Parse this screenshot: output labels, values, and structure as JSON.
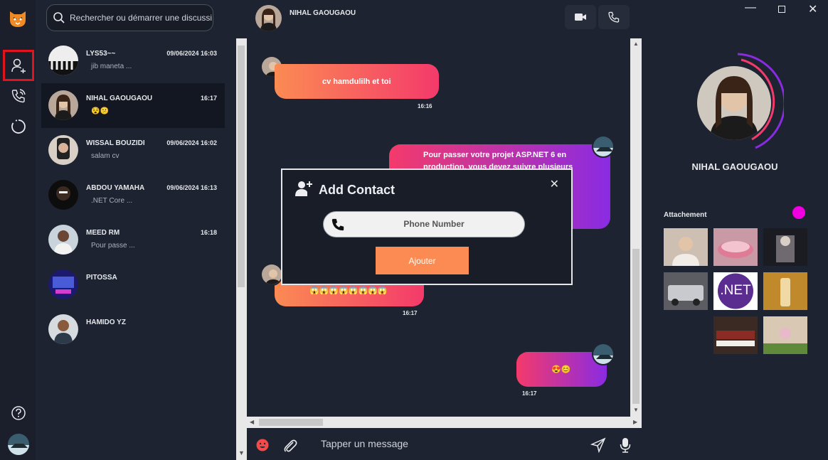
{
  "colors": {
    "accent_orange": "#fb8b53",
    "gradient_pink": "#f43a6b",
    "gradient_purple": "#8a2be2",
    "active_red": "#e0141e",
    "magenta_dot": "#f000e0"
  },
  "rail": {
    "items": [
      {
        "icon": "logo-tiger-icon"
      },
      {
        "icon": "add-contact-icon",
        "active": true
      },
      {
        "icon": "phone-call-icon"
      },
      {
        "icon": "status-ring-icon"
      },
      {
        "icon": "help-icon"
      },
      {
        "icon": "user-avatar-icon"
      }
    ]
  },
  "search": {
    "placeholder": "Rechercher ou démarrer une discussion"
  },
  "contacts": [
    {
      "name": "LYS53~~",
      "time": "09/06/2024 16:03",
      "preview": "jib maneta ..."
    },
    {
      "name": "NIHAL GAOUGAOU",
      "time": "16:17",
      "preview": "😵😕",
      "selected": true
    },
    {
      "name": "WISSAL BOUZIDI",
      "time": "09/06/2024 16:02",
      "preview": "salam cv"
    },
    {
      "name": "ABDOU YAMAHA",
      "time": "09/06/2024 16:13",
      "preview": ".NET Core   ..."
    },
    {
      "name": "MEED RM",
      "time": "16:18",
      "preview": "Pour passe ..."
    },
    {
      "name": "PITOSSA",
      "time": "",
      "preview": ""
    },
    {
      "name": "HAMIDO YZ",
      "time": "",
      "preview": ""
    }
  ],
  "header": {
    "name": "NIHAL GAOUGAOU"
  },
  "messages": [
    {
      "text": "cv hamdulilh et toi",
      "time": "16:16"
    },
    {
      "text": "Pour passer votre projet ASP.NET 6 en production, vous devez suivre plusieurs",
      "time": ""
    },
    {
      "text": "😱😱😱😱😱😱😱😱",
      "time": "16:17"
    },
    {
      "text": "😍😊",
      "time": "16:17"
    }
  ],
  "composer": {
    "placeholder": "Tapper un message"
  },
  "profile": {
    "name": "NIHAL GAOUGAOU",
    "attachments_label": "Attachement"
  },
  "attachments": [
    {
      "label": ""
    },
    {
      "label": ""
    },
    {
      "label": ""
    },
    {
      "label": ""
    },
    {
      "label": ".NET"
    },
    {
      "label": ""
    },
    {
      "label": ""
    },
    {
      "label": ""
    }
  ],
  "modal": {
    "title": "Add Contact",
    "phone_placeholder": "Phone Number",
    "submit_label": "Ajouter"
  }
}
